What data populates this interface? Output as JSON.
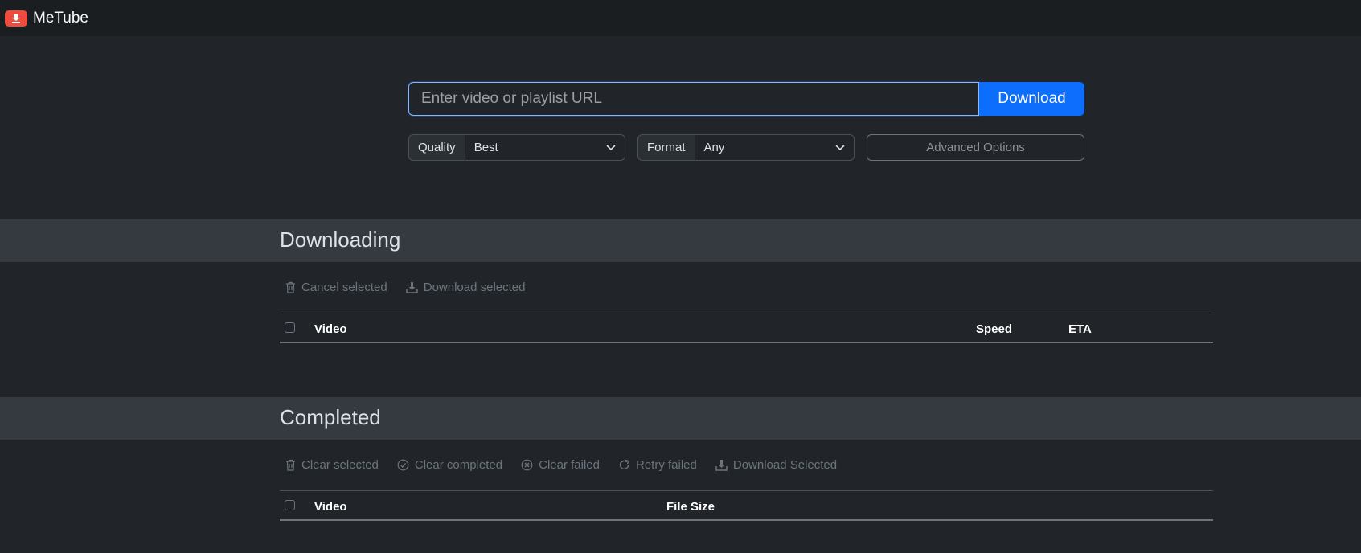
{
  "app": {
    "title": "MeTube",
    "logo_icon": "download-icon",
    "brand_color": "#ef4b3f"
  },
  "url_form": {
    "placeholder": "Enter video or playlist URL",
    "value": "",
    "download_label": "Download"
  },
  "options": {
    "quality_label": "Quality",
    "quality_value": "Best",
    "format_label": "Format",
    "format_value": "Any",
    "advanced_label": "Advanced Options"
  },
  "downloading": {
    "title": "Downloading",
    "actions": [
      {
        "label": "Cancel selected",
        "icon": "trash-icon"
      },
      {
        "label": "Download selected",
        "icon": "download-icon"
      }
    ],
    "columns": {
      "video": "Video",
      "speed": "Speed",
      "eta": "ETA"
    }
  },
  "completed": {
    "title": "Completed",
    "actions": [
      {
        "label": "Clear selected",
        "icon": "trash-icon"
      },
      {
        "label": "Clear completed",
        "icon": "check-circle-icon"
      },
      {
        "label": "Clear failed",
        "icon": "x-circle-icon"
      },
      {
        "label": "Retry failed",
        "icon": "redo-icon"
      },
      {
        "label": "Download Selected",
        "icon": "download-icon"
      }
    ],
    "columns": {
      "video": "Video",
      "file_size": "File Size"
    }
  },
  "colors": {
    "accent": "#0d6efd",
    "background": "#212529",
    "band": "#343a40",
    "navbar": "#1b1e21"
  }
}
